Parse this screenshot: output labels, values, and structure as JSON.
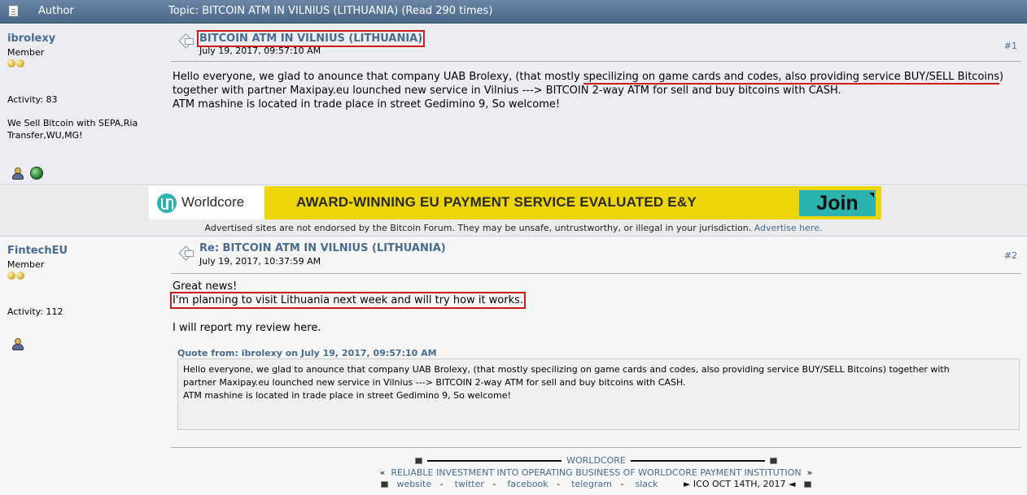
{
  "header": {
    "author_label": "Author",
    "topic": "Topic: BITCOIN ATM IN VILNIUS (LITHUANIA)  (Read 290 times)"
  },
  "post1": {
    "poster": {
      "name": "ibrolexy",
      "rank": "Member",
      "activity": "Activity: 83",
      "personal_text": "We Sell Bitcoin with SEPA,Ria Transfer,WU,MG!"
    },
    "subject": "BITCOIN ATM IN VILNIUS (LITHUANIA)",
    "date": "July 19, 2017, 09:57:10 AM",
    "number": "#1",
    "body": {
      "l1_a": "Hello everyone, we glad to anounce that company UAB Brolexy,  (that mostly ",
      "l1_b": "specilizing on game cards and codes, also providing service BUY/SELL Bitcoins",
      "l1_c": ")",
      "l2": "together with partner Maxipay.eu lounched new service in Vilnius ---> BITCOIN 2-way ATM for sell and buy bitcoins with CASH.",
      "l3": "ATM mashine is located in trade place in street Gedimino 9, So welcome!"
    }
  },
  "ad": {
    "brand": "Worldcore",
    "headline": "AWARD-WINNING EU PAYMENT SERVICE EVALUATED E&Y",
    "cta": "Join",
    "disclaimer": "Advertised sites are not endorsed by the Bitcoin Forum. They may be unsafe, untrustworthy, or illegal in your jurisdiction.",
    "advertise_link": "Advertise here."
  },
  "post2": {
    "poster": {
      "name": "FintechEU",
      "rank": "Member",
      "activity": "Activity: 112"
    },
    "subject": "Re: BITCOIN ATM IN VILNIUS (LITHUANIA)",
    "date": "July 19, 2017, 10:37:59 AM",
    "number": "#2",
    "body": {
      "l1": "Great news!",
      "l2": "I'm planning to visit Lithuania next week and will try how it works.",
      "l3": "I will report my review here."
    },
    "quote": {
      "header": "Quote from: ibrolexy on July 19, 2017, 09:57:10 AM",
      "l1": "Hello everyone, we glad to anounce that company UAB Brolexy,  (that mostly specilizing on game cards and codes, also providing service BUY/SELL Bitcoins) together with",
      "l2": "partner Maxipay.eu lounched new service in Vilnius ---> BITCOIN 2-way ATM for sell and buy bitcoins with CASH.",
      "l3": "ATM mashine is located in trade place in street Gedimino 9, So welcome!"
    },
    "signature": {
      "title": "WORLDCORE",
      "left_q": "«",
      "right_q": "»",
      "tagline": "RELIABLE INVESTMENT INTO OPERATING BUSINESS OF WORLDCORE PAYMENT INSTITUTION",
      "links": [
        "website",
        "twitter",
        "facebook",
        "telegram",
        "slack"
      ],
      "dash": "-",
      "ico": "► ICO OCT 14TH, 2017 ◄"
    }
  }
}
